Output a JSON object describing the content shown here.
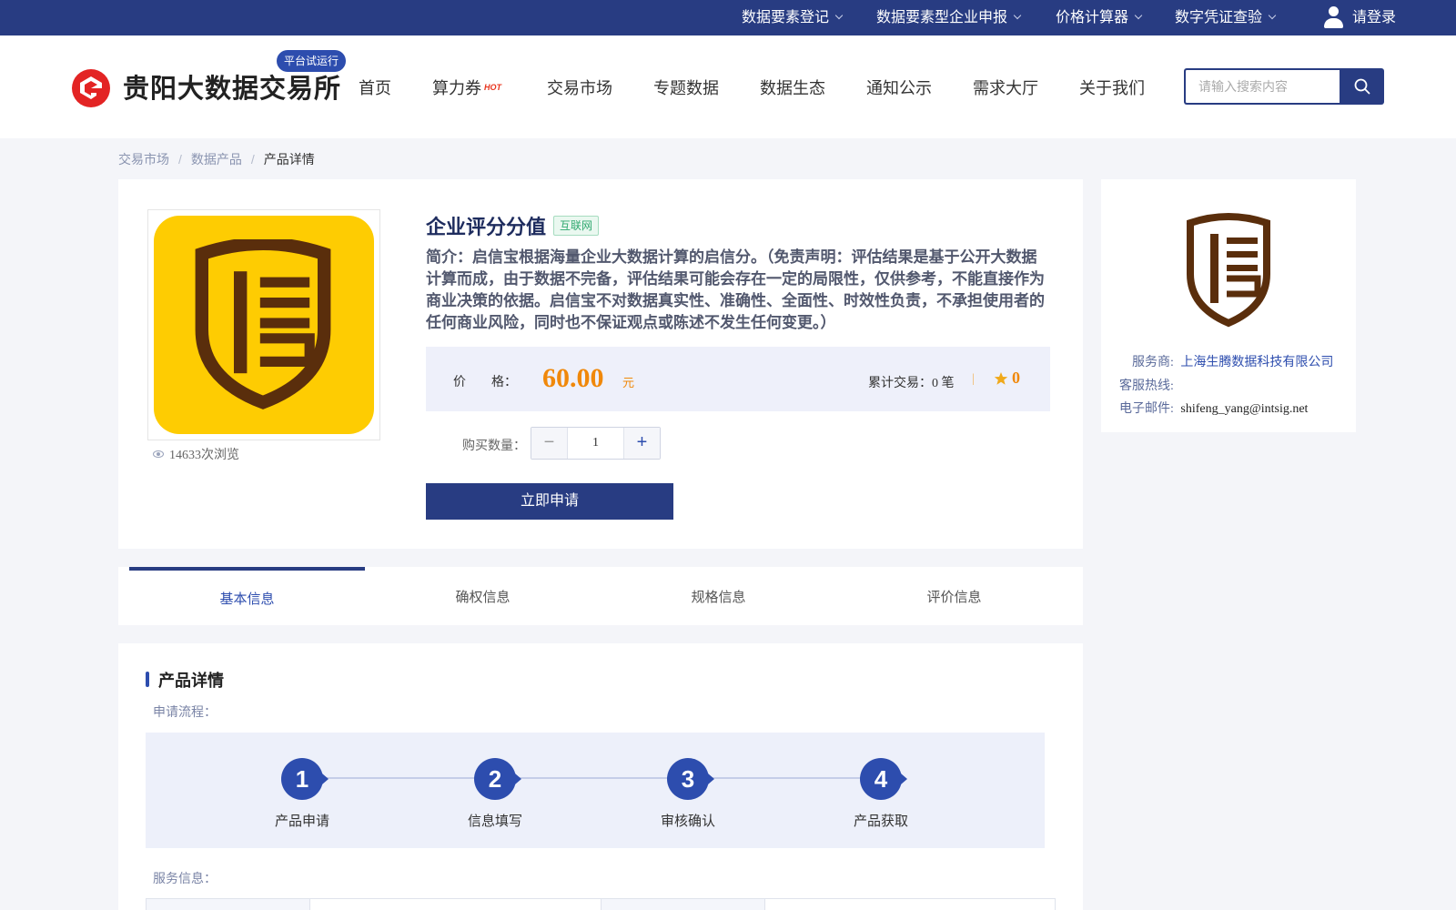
{
  "topbar": {
    "items": [
      {
        "label": "数据要素登记"
      },
      {
        "label": "数据要素型企业申报"
      },
      {
        "label": "价格计算器"
      },
      {
        "label": "数字凭证查验"
      }
    ],
    "login_label": "请登录"
  },
  "header": {
    "logo_text": "贵阳大数据交易所",
    "trial_badge": "平台试运行",
    "nav": [
      "首页",
      "算力券",
      "交易市场",
      "专题数据",
      "数据生态",
      "通知公示",
      "需求大厅",
      "关于我们"
    ],
    "hot_badge": "HOT",
    "search_placeholder": "请输入搜索内容"
  },
  "breadcrumb": [
    "交易市场",
    "数据产品",
    "产品详情"
  ],
  "product": {
    "title": "企业评分分值",
    "tag": "互联网",
    "intro": "简介：启信宝根据海量企业大数据计算的启信分。（免责声明：评估结果是基于公开大数据计算而成，由于数据不完备，评估结果可能会存在一定的局限性，仅供参考，不能直接作为商业决策的依据。启信宝不对数据真实性、准确性、全面性、时效性负责，不承担使用者的任何商业风险，同时也不保证观点或陈述不发生任何变更。）",
    "views": "14633次浏览",
    "price_label": "价  格：",
    "price": "60.00",
    "price_unit": "元",
    "trade_count": "累计交易：0 笔",
    "rating": "0",
    "qty_label": "购买数量：",
    "qty_value": "1",
    "apply_label": "立即申请"
  },
  "vendor": {
    "provider_label": "服务商:",
    "provider": "上海生腾数据科技有限公司",
    "hotline_label": "客服热线:",
    "hotline": "",
    "email_label": "电子邮件:",
    "email": "shifeng_yang@intsig.net"
  },
  "tabs": [
    "基本信息",
    "确权信息",
    "规格信息",
    "评价信息"
  ],
  "detail": {
    "title": "产品详情",
    "flow_label": "申请流程：",
    "steps": [
      {
        "num": "1",
        "label": "产品申请"
      },
      {
        "num": "2",
        "label": "信息填写"
      },
      {
        "num": "3",
        "label": "审核确认"
      },
      {
        "num": "4",
        "label": "产品获取"
      }
    ],
    "service_label": "服务信息："
  },
  "colors": {
    "primary": "#283c82",
    "accent": "#2d4dae",
    "price": "#f0880a",
    "logo_yellow": "#fecc02",
    "logo_brown": "#5a2e0c",
    "logo_red": "#e32424"
  }
}
